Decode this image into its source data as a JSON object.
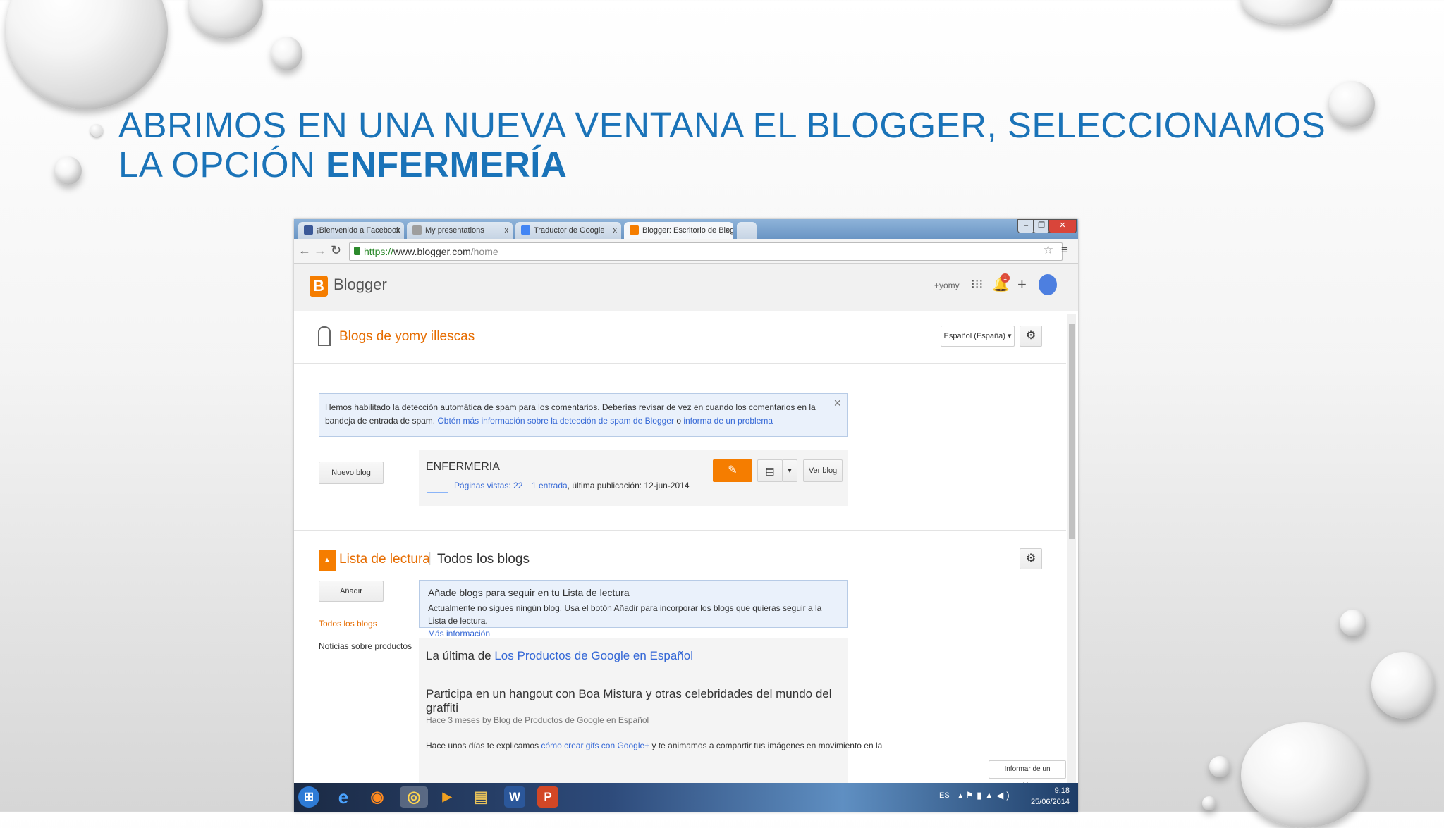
{
  "slide": {
    "title_prefix": "ABRIMOS EN UNA NUEVA VENTANA EL BLOGGER,  SELECCIONAMOS LA OPCIÓN ",
    "title_bold": "ENFERMERÍA"
  },
  "browser": {
    "tabs": [
      {
        "label": "¡Bienvenido a Facebook",
        "close": "x",
        "icon_color": "#3b5998"
      },
      {
        "label": "My presentations",
        "close": "x",
        "icon_color": "#9e9e9e"
      },
      {
        "label": "Traductor de Google",
        "close": "x",
        "icon_color": "#4285f4"
      },
      {
        "label": "Blogger: Escritorio de Blog",
        "close": "x",
        "icon_color": "#f57d00"
      }
    ],
    "url_scheme": "https://",
    "url_host": "www.blogger.com",
    "url_path": "/home"
  },
  "blogger": {
    "logo_letter": "B",
    "app_name": "Blogger",
    "user": "+yomy",
    "notifications": "1",
    "plus": "+",
    "blogs_title": "Blogs de yomy illescas",
    "language": "Español (España)",
    "notice_text": "Hemos habilitado la detección automática de spam para los comentarios. Deberías revisar de vez en cuando los comentarios en la bandeja de entrada de spam. ",
    "notice_link1": "Obtén más información sobre la detección de spam de Blogger",
    "notice_or": " o ",
    "notice_link2": "informa de un problema",
    "notice_close": "×",
    "new_blog": "Nuevo blog",
    "blog_name": "ENFERMERIA",
    "views": "Páginas vistas: 22",
    "entries": "1 entrada",
    "last_post": ", última publicación: 12-jun-2014",
    "view_blog": "Ver blog",
    "reading_list": "Lista de lectura",
    "all_blogs": "Todos los blogs",
    "add": "Añadir",
    "side_all_blogs": "Todos los blogs",
    "side_news": "Noticias sobre productos",
    "info_title": "Añade blogs para seguir en tu Lista de lectura",
    "info_text": "Actualmente no sigues ningún blog. Usa el botón Añadir para incorporar los blogs que quieras seguir a la Lista de lectura.",
    "info_link": "Más información",
    "latest_prefix": "La última de ",
    "latest_link": "Los Productos de Google en Español",
    "post_title": "Participa en un hangout con Boa Mistura y otras celebridades del mundo del graffiti",
    "post_meta": "Hace 3 meses by Blog de Productos de Google en Español",
    "post_excerpt_a": "Hace unos días te explicamos ",
    "post_excerpt_link": "cómo crear gifs con Google+",
    "post_excerpt_b": " y te animamos a compartir tus imágenes en movimiento en la",
    "report_problem": "Informar de un problema"
  },
  "taskbar": {
    "apps": [
      {
        "name": "start",
        "glyph": "⊞",
        "color": "#2e7bd6"
      },
      {
        "name": "ie",
        "glyph": "e",
        "color": "#1e74c8"
      },
      {
        "name": "firefox",
        "glyph": "◉",
        "color": "#e66000"
      },
      {
        "name": "chrome",
        "glyph": "◎",
        "color": "#4caf50"
      },
      {
        "name": "media",
        "glyph": "▶",
        "color": "#f0a020"
      },
      {
        "name": "explorer",
        "glyph": "▤",
        "color": "#e6c15a"
      },
      {
        "name": "word",
        "glyph": "W",
        "color": "#2b579a"
      },
      {
        "name": "powerpoint",
        "glyph": "P",
        "color": "#d24726"
      }
    ],
    "lang": "ES",
    "time": "9:18",
    "date": "25/06/2014"
  }
}
